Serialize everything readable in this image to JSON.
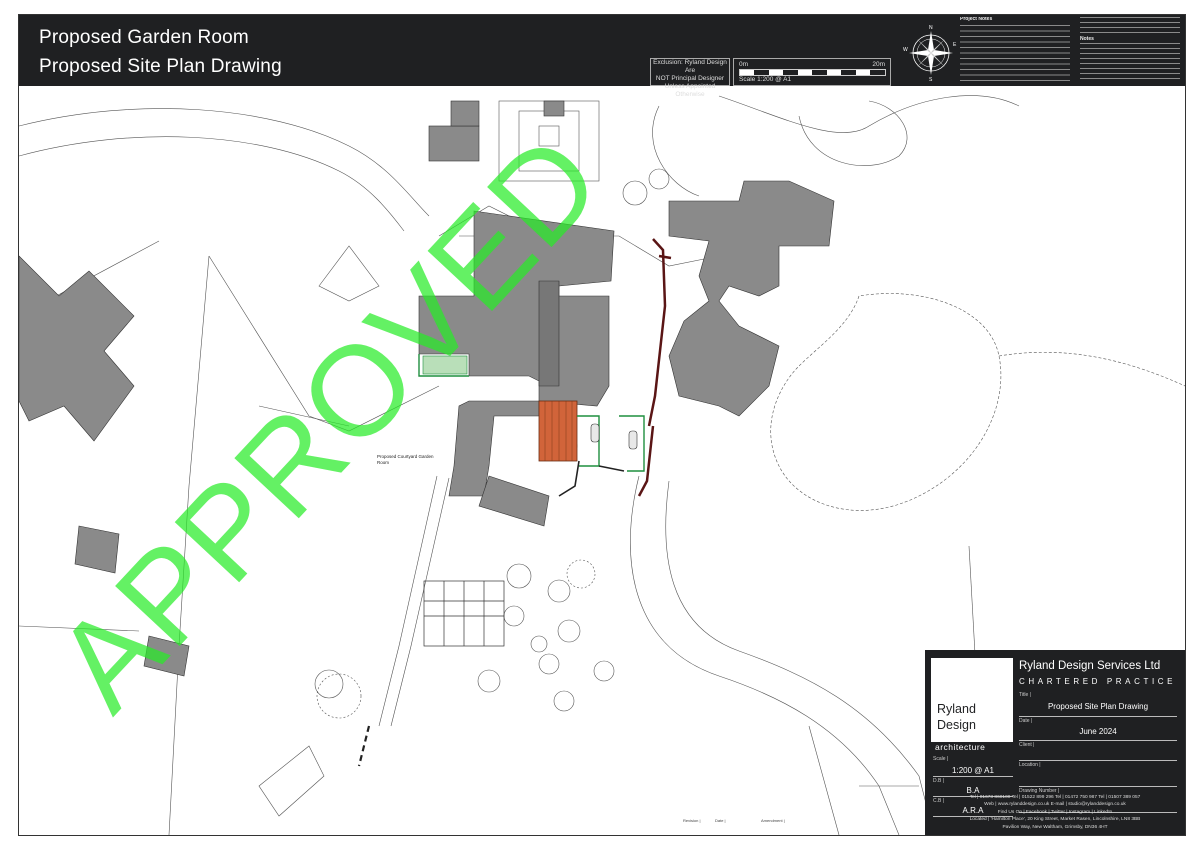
{
  "header": {
    "title_line1": "Proposed Garden Room",
    "title_line2": "Proposed Site Plan Drawing",
    "exclusion": [
      "Exclusion: Ryland Design Are",
      "NOT Principal Designer",
      "Unless Appointed Otherwise"
    ],
    "scale_bar": {
      "start": "0m",
      "end": "20m",
      "label": "Scale 1:200 @ A1"
    },
    "compass": {
      "icon": "compass-rose-icon",
      "letters": [
        "N",
        "E",
        "S",
        "W"
      ]
    },
    "notes_heading_1": "Project Notes",
    "notes_heading_2": "Notes"
  },
  "plan": {
    "label_courtyard": [
      "Proposed Courtyard Garden",
      "Room"
    ],
    "stamp": "APPROVED",
    "colors": {
      "buildings": "#8a8a8a",
      "proposed_deck": "#d1643a",
      "green_outline": "#1f8f3f",
      "boundary_red": "#5a1515",
      "stamp": "#28eb28"
    }
  },
  "title_block": {
    "logo": {
      "line1": "Ryland",
      "line2": "Design",
      "line3": "architecture"
    },
    "company": "Ryland Design Services Ltd",
    "subtitle": "CHARTERED PRACTICE",
    "fields": {
      "title_label": "Title |",
      "title": "Proposed Site Plan Drawing",
      "date_label": "Date |",
      "date": "June 2024",
      "client_label": "Client |",
      "location_label": "Location |",
      "scale_label": "Scale |",
      "scale": "1:200 @ A1",
      "db_label": "D.B |",
      "db": "B.A",
      "cb_label": "C.B |",
      "cb": "A.R.A",
      "drawing_number_label": "Drawing Number |"
    },
    "contacts": {
      "phones": "Tel | 01673 860100   Tel | 01522 899 296   Tel | 01472 750 987   Tel | 01507 389 057",
      "web": "Web | www.rylanddesign.co.uk   E-mail | studio@rylanddesign.co.uk",
      "social": "Find Us On | Facebook | Twitter | Instagram | LinkedIn",
      "address1": "Located | 'Hamilton Place', 20 King Street, Market Rasen, Lincolnshire, LN8 3BB",
      "address2": "Pavilion Way, New Waltham, Grimsby, DN36 4HT"
    }
  },
  "revision_table": {
    "revision": "Revision |",
    "date": "Date |",
    "amendment": "Amendment |"
  }
}
